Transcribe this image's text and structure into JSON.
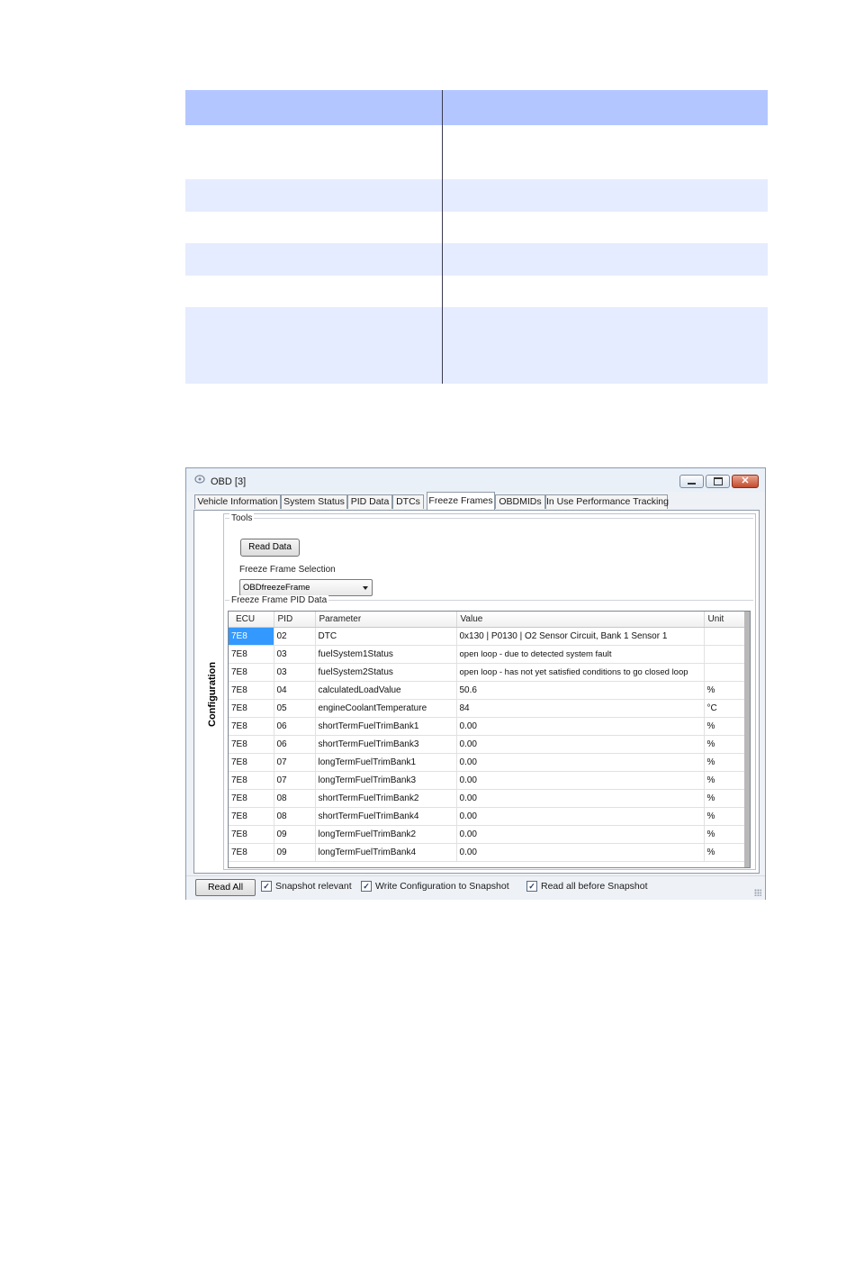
{
  "doc_table": {
    "rows": [
      {
        "style": "hdr",
        "height": 39
      },
      {
        "style": "plain",
        "height": 60
      },
      {
        "style": "stripe",
        "height": 36
      },
      {
        "style": "plain",
        "height": 35
      },
      {
        "style": "stripe",
        "height": 36
      },
      {
        "style": "plain",
        "height": 35
      },
      {
        "style": "stripe",
        "height": 85
      }
    ]
  },
  "window": {
    "title": "OBD [3]",
    "tabs": [
      "Vehicle Information",
      "System Status",
      "PID Data",
      "DTCs",
      "Freeze Frames",
      "OBDMIDs",
      "In Use Performance Tracking"
    ],
    "active_tab": "Freeze Frames",
    "side_label": "Configuration",
    "tools": {
      "legend": "Tools",
      "read_data_label": "Read Data",
      "freeze_frame_selection_label": "Freeze Frame Selection",
      "freeze_frame_selected": "OBDfreezeFrame"
    },
    "pid_data": {
      "legend": "Freeze Frame PID Data",
      "columns": [
        "ECU",
        "PID",
        "Parameter",
        "Value",
        "Unit"
      ],
      "rows": [
        [
          "7E8",
          "02",
          "DTC",
          "0x130 | P0130 | O2 Sensor Circuit, Bank 1 Sensor 1",
          ""
        ],
        [
          "7E8",
          "03",
          "fuelSystem1Status",
          "open loop - due to detected system fault",
          ""
        ],
        [
          "7E8",
          "03",
          "fuelSystem2Status",
          "open loop - has not yet satisfied conditions to go closed loop",
          ""
        ],
        [
          "7E8",
          "04",
          "calculatedLoadValue",
          "50.6",
          "%"
        ],
        [
          "7E8",
          "05",
          "engineCoolantTemperature",
          "84",
          "°C"
        ],
        [
          "7E8",
          "06",
          "shortTermFuelTrimBank1",
          "0.00",
          "%"
        ],
        [
          "7E8",
          "06",
          "shortTermFuelTrimBank3",
          "0.00",
          "%"
        ],
        [
          "7E8",
          "07",
          "longTermFuelTrimBank1",
          "0.00",
          "%"
        ],
        [
          "7E8",
          "07",
          "longTermFuelTrimBank3",
          "0.00",
          "%"
        ],
        [
          "7E8",
          "08",
          "shortTermFuelTrimBank2",
          "0.00",
          "%"
        ],
        [
          "7E8",
          "08",
          "shortTermFuelTrimBank4",
          "0.00",
          "%"
        ],
        [
          "7E8",
          "09",
          "longTermFuelTrimBank2",
          "0.00",
          "%"
        ],
        [
          "7E8",
          "09",
          "longTermFuelTrimBank4",
          "0.00",
          "%"
        ]
      ]
    },
    "statusbar": {
      "read_all_label": "Read All",
      "checkboxes": [
        {
          "label": "Snapshot relevant",
          "checked": true
        },
        {
          "label": "Write Configuration to Snapshot",
          "checked": true
        },
        {
          "label": "Read all before Snapshot",
          "checked": true
        }
      ]
    }
  },
  "colors": {
    "header_blue": "#b3c6ff",
    "stripe_blue": "#e6ecff",
    "selection": "#3399ff"
  }
}
